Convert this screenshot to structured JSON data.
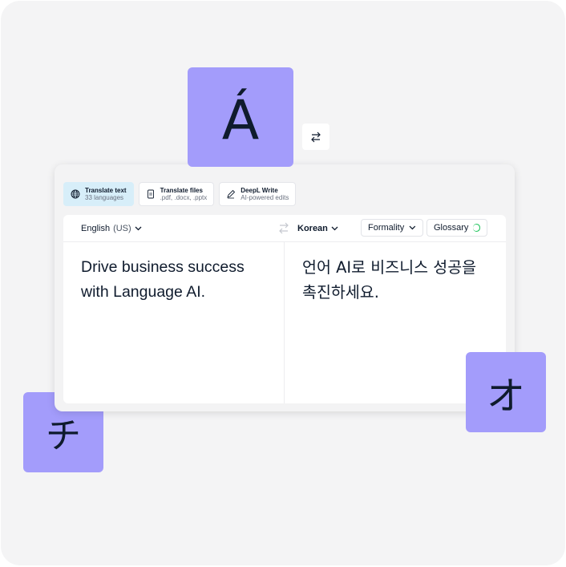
{
  "tiles": {
    "accent_glyph": "Á",
    "katakana_chi": "チ",
    "katakana_o": "オ"
  },
  "modes": [
    {
      "title": "Translate text",
      "subtitle": "33 languages",
      "icon": "globe-icon"
    },
    {
      "title": "Translate files",
      "subtitle": ".pdf, .docx, .pptx",
      "icon": "file-icon"
    },
    {
      "title": "DeepL Write",
      "subtitle": "AI-powered edits",
      "icon": "pen-icon"
    }
  ],
  "editor": {
    "source_lang": "English",
    "source_region": "(US)",
    "target_lang": "Korean",
    "formality_label": "Formality",
    "glossary_label": "Glossary",
    "glossary_on": true,
    "source_text": "Drive business success with Language AI.",
    "target_text": "언어 AI로 비즈니스 성공을 촉진하세요."
  },
  "colors": {
    "tile": "#a39cfb",
    "active_mode": "#d7eef9",
    "toggle_on": "#22c55e",
    "text": "#0f1b2d"
  }
}
